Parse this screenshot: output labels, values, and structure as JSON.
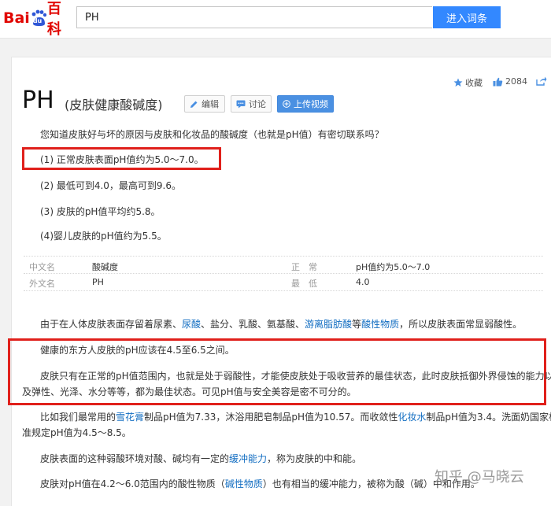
{
  "header": {
    "logo_text_a": "Bai",
    "logo_text_b": "du",
    "logo_text_c": "百科",
    "search_value": "PH",
    "search_button": "进入词条"
  },
  "actions": {
    "favorite": "收藏",
    "like_count": "2084"
  },
  "entry": {
    "title": "PH",
    "subtitle": "(皮肤健康酸碱度)",
    "edit": "编辑",
    "discuss": "讨论",
    "upload_video": "上传视频"
  },
  "intro": {
    "question": "您知道皮肤好与坏的原因与皮肤和化妆品的酸碱度（也就是pH值）有密切联系吗？",
    "points": [
      "(1) 正常皮肤表面pH值约为5.0～7.0。",
      "(2) 最低可到4.0，最高可到9.6。",
      "(3) 皮肤的pH值平均约5.8。",
      "(4)婴儿皮肤的pH值约为5.5。"
    ]
  },
  "infobox": [
    {
      "label": "中文名",
      "value": "酸碱度",
      "label2": "正　常",
      "value2": "pH值约为5.0～7.0"
    },
    {
      "label": "外文名",
      "value": "PH",
      "label2": "最　低",
      "value2": "4.0"
    }
  ],
  "body": {
    "p1_a": "由于在人体皮肤表面存留着尿素、",
    "p1_link1": "尿酸",
    "p1_b": "、盐分、乳酸、氨基酸、",
    "p1_link2": "游离脂肪酸",
    "p1_c": "等",
    "p1_link3": "酸性物质",
    "p1_d": "，所以皮肤表面常显弱酸性。",
    "p2": "健康的东方人皮肤的pH应该在4.5至6.5之间。",
    "p3_line1": "皮肤只有在正常的pH值范围内，也就是处于弱酸性，才能使皮肤处于吸收营养的最佳状态，此时皮肤抵御外界侵蚀的能力以",
    "p3_line2": "及弹性、光泽、水分等等，都为最佳状态。可见pH值与安全美容是密不可分的。",
    "p4_a": "比如我们最常用的",
    "p4_link1": "雪花膏",
    "p4_b": "制品pH值为7.33，沐浴用肥皂制品pH值为10.57。而收敛性",
    "p4_link2": "化妆水",
    "p4_c": "制品pH值为3.4。洗面奶国家标",
    "p4_line2": "准规定pH值为4.5～8.5。",
    "p5_a": "皮肤表面的这种弱酸环境对酸、碱均有一定的",
    "p5_link": "缓冲能力",
    "p5_b": "，称为皮肤的中和能。",
    "p6_a": "皮肤对pH值在4.2～6.0范围内的酸性物质（",
    "p6_link": "碱性物质",
    "p6_b": "）也有相当的缓冲能力，被称为酸（碱）中和作用。"
  },
  "watermark": "知乎 @马晓云",
  "colors": {
    "accent": "#3388ff",
    "link": "#136ec2",
    "highlight_box": "#e0201b"
  }
}
